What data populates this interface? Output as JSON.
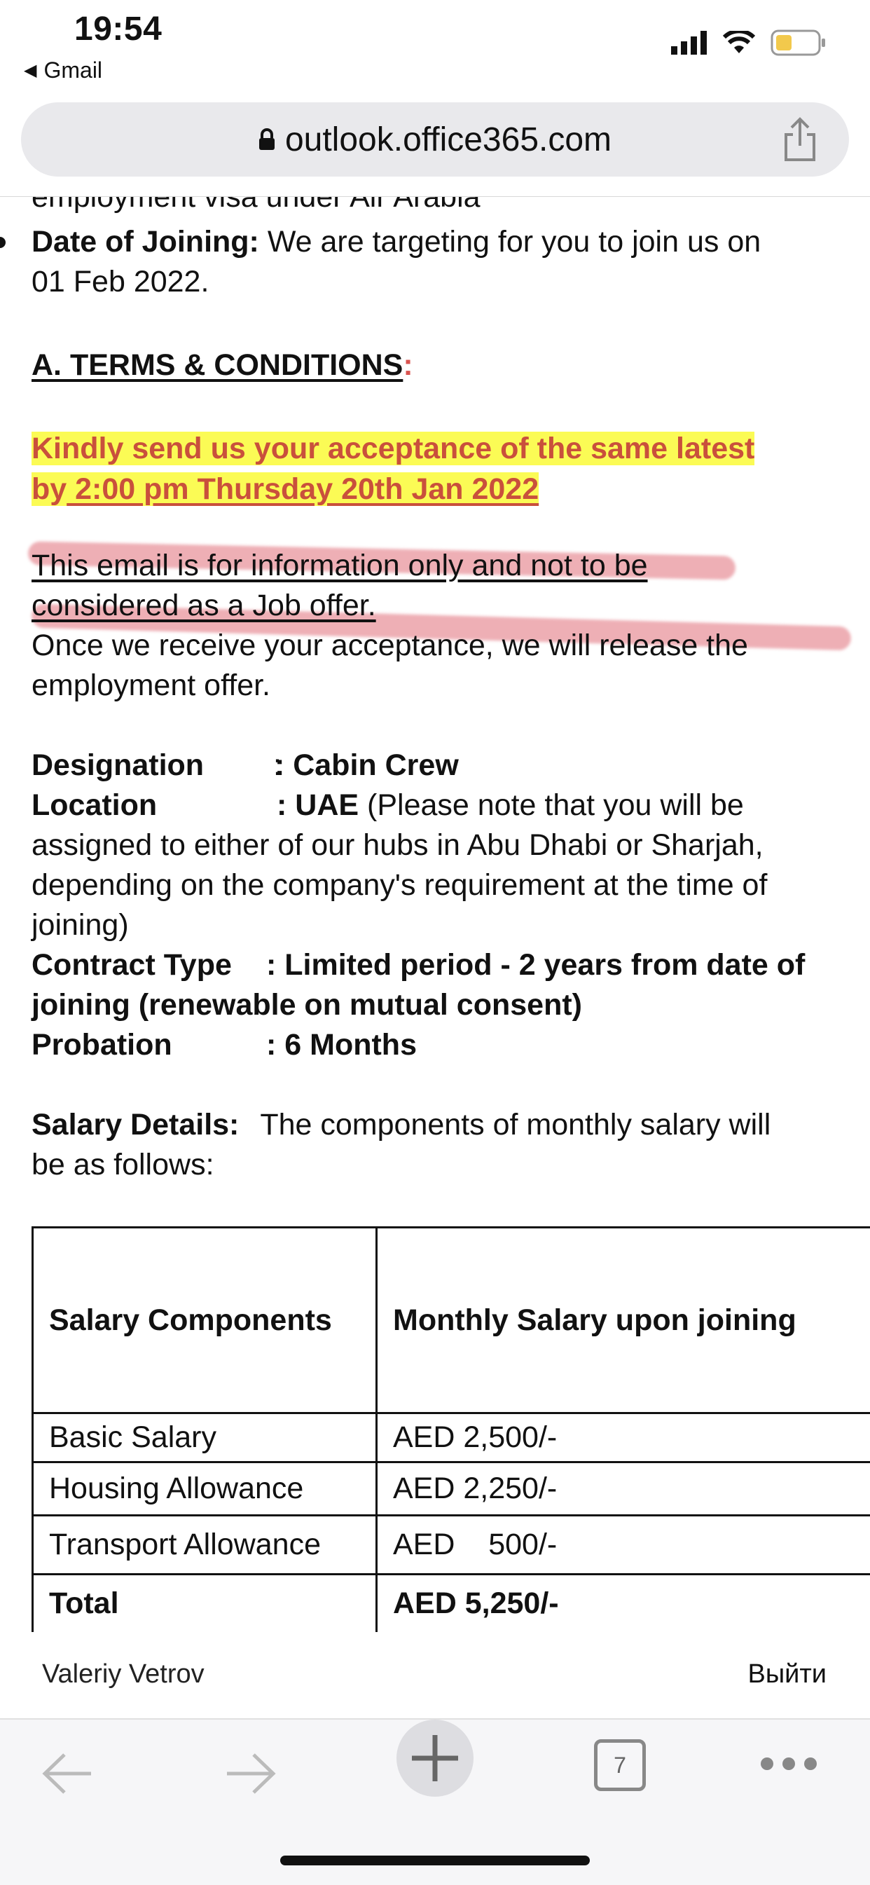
{
  "status_bar": {
    "time": "19:54",
    "back_app": "Gmail"
  },
  "browser": {
    "url": "outlook.office365.com"
  },
  "email": {
    "partial_top": "employment visa under Air Arabia",
    "date_of_joining_label": "Date of Joining:",
    "date_of_joining_text_1": "We are targeting for you to join us on",
    "date_of_joining_text_2": "01 Feb 2022.",
    "section_title": "A. TERMS & CONDITIONS",
    "section_colon": ":",
    "deadline_1": "Kindly send us your acceptance of the same latest",
    "deadline_2a": "by",
    "deadline_2b": " 2:00 pm Thursday 20th Jan 2022",
    "info_1": "This email is for information only and not to be",
    "info_2": "considered as a Job offer.",
    "once_1": "Once we receive your acceptance, we will release the",
    "once_2": "employment offer.",
    "designation_label": "Designation",
    "designation_value": ": Cabin Crew",
    "location_label": "Location",
    "location_value": ": UAE",
    "location_note_1": "(Please note that you will be",
    "location_note_2": "assigned to either of our hubs in Abu Dhabi or Sharjah,",
    "location_note_3": "depending on the company's requirement at the time of",
    "location_note_4": "joining)",
    "contract_label": "Contract Type",
    "contract_value_1": ": Limited period - 2 years from date of",
    "contract_value_2": "joining (renewable on mutual consent)",
    "probation_label": "Probation",
    "probation_value": ": 6 Months",
    "salary_label": "Salary Details:",
    "salary_text_1": "The components of monthly salary will",
    "salary_text_2": "be as follows:"
  },
  "salary_table": {
    "headers": [
      "Salary Components",
      "Monthly Salary upon joining"
    ],
    "rows": [
      [
        "Basic Salary",
        "AED 2,500/-"
      ],
      [
        "Housing Allowance",
        "AED 2,250/-"
      ],
      [
        "Transport Allowance",
        "AED    500/-"
      ],
      [
        "Total",
        "AED 5,250/-"
      ]
    ]
  },
  "footer": {
    "user": "Valeriy Vetrov",
    "logout": "Выйти"
  },
  "toolbar": {
    "tabs_count": "7"
  },
  "colors": {
    "highlight": "#fbfb55",
    "red_text": "#c9503c",
    "annotation": "#e06e78"
  }
}
